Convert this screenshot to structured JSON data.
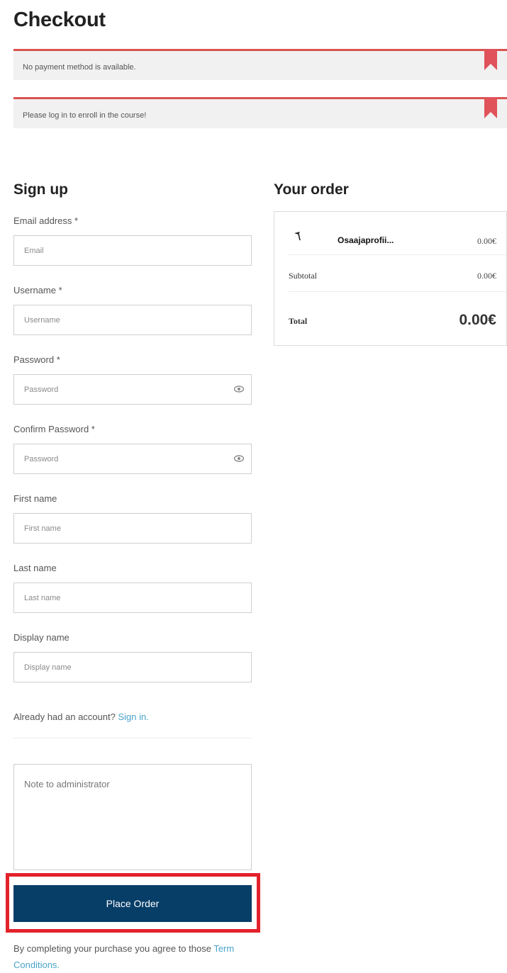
{
  "page": {
    "title": "Checkout"
  },
  "notices": [
    {
      "text": "No payment method is available."
    },
    {
      "text": "Please log in to enroll in the course!"
    }
  ],
  "signup": {
    "title": "Sign up",
    "fields": {
      "email": {
        "label": "Email address *",
        "placeholder": "Email"
      },
      "username": {
        "label": "Username *",
        "placeholder": "Username"
      },
      "password": {
        "label": "Password *",
        "placeholder": "Password"
      },
      "confirm_password": {
        "label": "Confirm Password *",
        "placeholder": "Password"
      },
      "first_name": {
        "label": "First name",
        "placeholder": "First name"
      },
      "last_name": {
        "label": "Last name",
        "placeholder": "Last name"
      },
      "display_name": {
        "label": "Display name",
        "placeholder": "Display name"
      }
    },
    "already_text": "Already had an account? ",
    "signin_link": "Sign in.",
    "note_placeholder": "Note to administrator",
    "place_order_label": "Place Order",
    "agree_text": "By completing your purchase you agree to those ",
    "terms_link": "Term Conditions."
  },
  "order": {
    "title": "Your order",
    "item": {
      "name": "Osaajaprofii...",
      "price": "0.00€",
      "icon": "pin-icon"
    },
    "subtotal_label": "Subtotal",
    "subtotal_value": "0.00€",
    "total_label": "Total",
    "total_value": "0.00€"
  },
  "colors": {
    "notice_border": "#d9534f",
    "button_bg": "#073e68",
    "highlight": "#e2222b",
    "link": "#4aa3c9"
  }
}
